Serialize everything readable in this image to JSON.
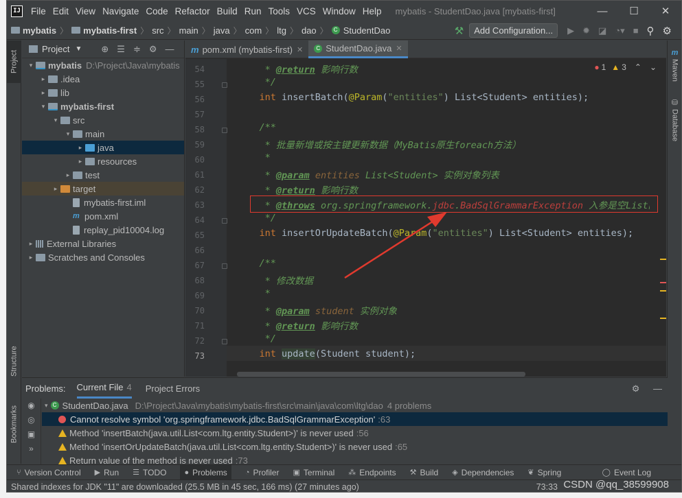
{
  "window": {
    "title": "mybatis - StudentDao.java [mybatis-first]",
    "menu": [
      "File",
      "Edit",
      "View",
      "Navigate",
      "Code",
      "Refactor",
      "Build",
      "Run",
      "Tools",
      "VCS",
      "Window",
      "Help"
    ]
  },
  "breadcrumb": [
    "mybatis",
    "mybatis-first",
    "src",
    "main",
    "java",
    "com",
    "ltg",
    "dao",
    "StudentDao"
  ],
  "toolbar": {
    "add_config_label": "Add Configuration..."
  },
  "left_stripe": {
    "project": "Project",
    "structure": "Structure",
    "bookmarks": "Bookmarks"
  },
  "right_stripe": {
    "maven": "Maven",
    "database": "Database"
  },
  "project_panel": {
    "title": "Project",
    "tree": [
      {
        "label": "mybatis",
        "extra": "D:\\Project\\Java\\mybatis",
        "indent": 0,
        "arrow": "▾",
        "icon": "module",
        "bold": true
      },
      {
        "label": ".idea",
        "indent": 1,
        "arrow": "▸",
        "icon": "folder"
      },
      {
        "label": "lib",
        "indent": 1,
        "arrow": "▸",
        "icon": "folder"
      },
      {
        "label": "mybatis-first",
        "indent": 1,
        "arrow": "▾",
        "icon": "module",
        "bold": true
      },
      {
        "label": "src",
        "indent": 2,
        "arrow": "▾",
        "icon": "folder"
      },
      {
        "label": "main",
        "indent": 3,
        "arrow": "▾",
        "icon": "folder"
      },
      {
        "label": "java",
        "indent": 4,
        "arrow": "▸",
        "icon": "blue",
        "selected": true
      },
      {
        "label": "resources",
        "indent": 4,
        "arrow": "▸",
        "icon": "folder"
      },
      {
        "label": "test",
        "indent": 3,
        "arrow": "▸",
        "icon": "folder"
      },
      {
        "label": "target",
        "indent": 2,
        "arrow": "▸",
        "icon": "orange",
        "excluded": true
      },
      {
        "label": "mybatis-first.iml",
        "indent": 3,
        "arrow": "",
        "icon": "file"
      },
      {
        "label": "pom.xml",
        "indent": 3,
        "arrow": "",
        "icon": "m"
      },
      {
        "label": "replay_pid10004.log",
        "indent": 3,
        "arrow": "",
        "icon": "file"
      },
      {
        "label": "External Libraries",
        "indent": 0,
        "arrow": "▸",
        "icon": "lib"
      },
      {
        "label": "Scratches and Consoles",
        "indent": 0,
        "arrow": "▸",
        "icon": "folder"
      }
    ]
  },
  "editor": {
    "tabs": [
      {
        "label": "pom.xml (mybatis-first)",
        "active": false
      },
      {
        "label": "StudentDao.java",
        "active": true
      }
    ],
    "inspections": {
      "errors": "1",
      "warnings": "3"
    },
    "current_line": "73",
    "lines": [
      {
        "n": "54",
        "tokens": [
          [
            "     * ",
            "c-doc"
          ],
          [
            "@return",
            "c-tag"
          ],
          [
            " 影响行数",
            "c-doc"
          ]
        ]
      },
      {
        "n": "55",
        "tokens": [
          [
            "     */",
            "c-doc"
          ]
        ]
      },
      {
        "n": "56",
        "tokens": [
          [
            "    ",
            ""
          ],
          [
            "int",
            "c-kw"
          ],
          [
            " insertBatch(",
            ""
          ],
          [
            "@Param",
            "c-ann"
          ],
          [
            "(",
            ""
          ],
          [
            "\"entities\"",
            "c-str"
          ],
          [
            ") List<Student> entities);",
            ""
          ]
        ]
      },
      {
        "n": "57",
        "tokens": []
      },
      {
        "n": "58",
        "tokens": [
          [
            "    /**",
            "c-doc"
          ]
        ]
      },
      {
        "n": "59",
        "tokens": [
          [
            "     * 批量新增或按主键更新数据（MyBatis原生foreach方法）",
            "c-doc"
          ]
        ]
      },
      {
        "n": "60",
        "tokens": [
          [
            "     *",
            "c-doc"
          ]
        ]
      },
      {
        "n": "61",
        "tokens": [
          [
            "     * ",
            "c-doc"
          ],
          [
            "@param",
            "c-tag"
          ],
          [
            " entities ",
            "c-par"
          ],
          [
            "List<Student>",
            "c-doc"
          ],
          [
            " 实例对象列表",
            "c-doc"
          ]
        ]
      },
      {
        "n": "62",
        "tokens": [
          [
            "     * ",
            "c-doc"
          ],
          [
            "@return",
            "c-tag"
          ],
          [
            " 影响行数",
            "c-doc"
          ]
        ]
      },
      {
        "n": "63",
        "tokens": [
          [
            "     * ",
            "c-doc"
          ],
          [
            "@throws",
            "c-tag"
          ],
          [
            " org.springframework.",
            "c-doc"
          ],
          [
            "jdbc",
            "c-err"
          ],
          [
            ".",
            "c-doc"
          ],
          [
            "BadSqlGrammarException",
            "c-err"
          ],
          [
            " 入参是空List的时候",
            "c-doc"
          ]
        ]
      },
      {
        "n": "64",
        "tokens": [
          [
            "     */",
            "c-doc"
          ]
        ]
      },
      {
        "n": "65",
        "tokens": [
          [
            "    ",
            ""
          ],
          [
            "int",
            "c-kw"
          ],
          [
            " insertOrUpdateBatch(",
            ""
          ],
          [
            "@Param",
            "c-ann"
          ],
          [
            "(",
            ""
          ],
          [
            "\"entities\"",
            "c-str"
          ],
          [
            ") List<Student> entities);",
            ""
          ]
        ]
      },
      {
        "n": "66",
        "tokens": []
      },
      {
        "n": "67",
        "tokens": [
          [
            "    /**",
            "c-doc"
          ]
        ]
      },
      {
        "n": "68",
        "tokens": [
          [
            "     * 修改数据",
            "c-doc"
          ]
        ]
      },
      {
        "n": "69",
        "tokens": [
          [
            "     *",
            "c-doc"
          ]
        ]
      },
      {
        "n": "70",
        "tokens": [
          [
            "     * ",
            "c-doc"
          ],
          [
            "@param",
            "c-tag"
          ],
          [
            " student ",
            "c-par"
          ],
          [
            "实例对象",
            "c-doc"
          ]
        ]
      },
      {
        "n": "71",
        "tokens": [
          [
            "     * ",
            "c-doc"
          ],
          [
            "@return",
            "c-tag"
          ],
          [
            " 影响行数",
            "c-doc"
          ]
        ]
      },
      {
        "n": "72",
        "tokens": [
          [
            "     */",
            "c-doc"
          ]
        ]
      },
      {
        "n": "73",
        "tokens": [
          [
            "    ",
            ""
          ],
          [
            "int",
            "c-kw"
          ],
          [
            " ",
            ""
          ],
          [
            "update",
            "c-hl"
          ],
          [
            "(Student student);",
            ""
          ]
        ]
      }
    ]
  },
  "problems": {
    "title": "Problems:",
    "tabs": [
      {
        "label": "Current File",
        "count": "4",
        "active": true
      },
      {
        "label": "Project Errors",
        "count": "",
        "active": false
      }
    ],
    "file": {
      "name": "StudentDao.java",
      "path": "D:\\Project\\Java\\mybatis\\mybatis-first\\src\\main\\java\\com\\ltg\\dao",
      "count": "4 problems"
    },
    "items": [
      {
        "severity": "error",
        "text": "Cannot resolve symbol 'org.springframework.jdbc.BadSqlGrammarException'",
        "loc": ":63",
        "selected": true
      },
      {
        "severity": "warning",
        "text": "Method 'insertBatch(java.util.List<com.ltg.entity.Student>)' is never used",
        "loc": ":56"
      },
      {
        "severity": "warning",
        "text": "Method 'insertOrUpdateBatch(java.util.List<com.ltg.entity.Student>)' is never used",
        "loc": ":65"
      },
      {
        "severity": "warning",
        "text": "Return value of the method is never used",
        "loc": ":73"
      }
    ]
  },
  "bottom_tools": [
    {
      "label": "Version Control",
      "glyph": "⑂"
    },
    {
      "label": "Run",
      "glyph": "▶"
    },
    {
      "label": "TODO",
      "glyph": "☰"
    },
    {
      "label": "Problems",
      "glyph": "●",
      "active": true
    },
    {
      "label": "Profiler",
      "glyph": "◔"
    },
    {
      "label": "Terminal",
      "glyph": "▣"
    },
    {
      "label": "Endpoints",
      "glyph": "⁂"
    },
    {
      "label": "Build",
      "glyph": "⚒"
    },
    {
      "label": "Dependencies",
      "glyph": "◈"
    },
    {
      "label": "Spring",
      "glyph": "❦"
    }
  ],
  "event_log": "Event Log",
  "status": {
    "message": "Shared indexes for JDK \"11\" are downloaded (25.5 MB in 45 sec, 166 ms) (27 minutes ago)",
    "position": "73:33"
  },
  "watermark": "CSDN @qq_38599908",
  "colors": {
    "accent": "#4a88c7",
    "error": "#e05555",
    "warning": "#e6b422",
    "annotation_box": "#e03a2e"
  }
}
